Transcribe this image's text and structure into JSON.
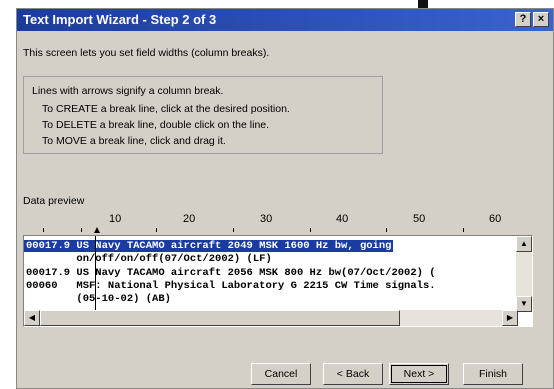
{
  "window": {
    "title": "Text Import Wizard - Step 2 of 3",
    "help_button": "?",
    "close_button": "×"
  },
  "intro_text": "This screen lets you set field widths (column breaks).",
  "instructions": {
    "line1": "Lines with arrows signify a column break.",
    "line2": "To CREATE a break line, click at the desired position.",
    "line3": "To DELETE a break line, double click on the line.",
    "line4": "To MOVE a break line, click and drag it."
  },
  "preview": {
    "label": "Data preview",
    "ruler_numbers": [
      "10",
      "20",
      "30",
      "40",
      "50",
      "60"
    ],
    "lines": [
      "00017.9 US Navy TACAMO aircraft 2049 MSK 1600 Hz bw, going",
      "        on/off/on/off(07/Oct/2002) (LF)",
      "00017.9 US Navy TACAMO aircraft 2056 MSK 800 Hz bw(07/Oct/2002) (",
      "00060   MSF: National Physical Laboratory G 2215 CW Time signals.",
      "        (05-10-02) (AB)"
    ]
  },
  "buttons": {
    "cancel": "Cancel",
    "back": "< Back",
    "next": "Next >",
    "finish": "Finish"
  },
  "icons": {
    "scroll_up": "▲",
    "scroll_down": "▼",
    "scroll_left": "◀",
    "scroll_right": "▶"
  }
}
